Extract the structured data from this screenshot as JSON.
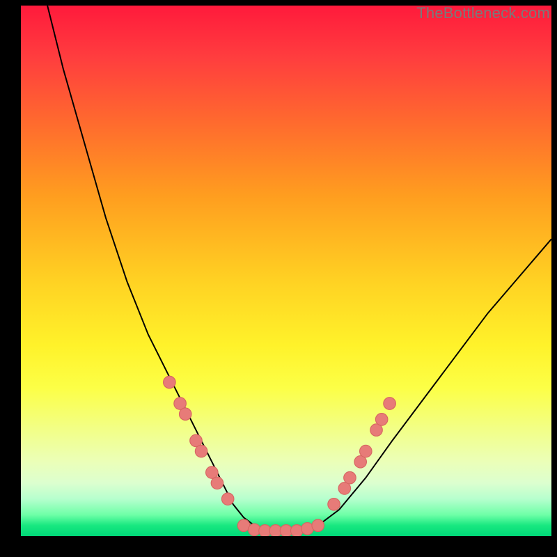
{
  "watermark": "TheBottleneck.com",
  "colors": {
    "curve": "#000000",
    "marker_fill": "#e77b78",
    "marker_stroke": "#d76662",
    "background_border": "#000000"
  },
  "chart_data": {
    "type": "line",
    "title": "",
    "xlabel": "",
    "ylabel": "",
    "xlim": [
      0,
      100
    ],
    "ylim": [
      0,
      100
    ],
    "grid": false,
    "legend": null,
    "series": [
      {
        "name": "bottleneck-curve",
        "x": [
          5,
          8,
          12,
          16,
          20,
          24,
          28,
          32,
          34,
          36,
          38,
          40,
          42,
          44,
          46,
          48,
          50,
          53,
          56,
          60,
          65,
          70,
          76,
          82,
          88,
          94,
          100
        ],
        "y": [
          100,
          88,
          74,
          60,
          48,
          38,
          30,
          22,
          18,
          14,
          10,
          6,
          3.5,
          2,
          1.2,
          1,
          1,
          1,
          2,
          5,
          11,
          18,
          26,
          34,
          42,
          49,
          56
        ]
      }
    ],
    "marker_series": [
      {
        "name": "left-branch-markers",
        "x": [
          28,
          30,
          31,
          33,
          34,
          36,
          37,
          39
        ],
        "y": [
          29,
          25,
          23,
          18,
          16,
          12,
          10,
          7
        ]
      },
      {
        "name": "floor-markers",
        "x": [
          42,
          44,
          46,
          48,
          50,
          52,
          54,
          56
        ],
        "y": [
          2,
          1.2,
          1,
          1,
          1,
          1,
          1.4,
          2
        ]
      },
      {
        "name": "right-branch-markers",
        "x": [
          59,
          61,
          62,
          64,
          65,
          67,
          68,
          69.5
        ],
        "y": [
          6,
          9,
          11,
          14,
          16,
          20,
          22,
          25
        ]
      }
    ]
  }
}
